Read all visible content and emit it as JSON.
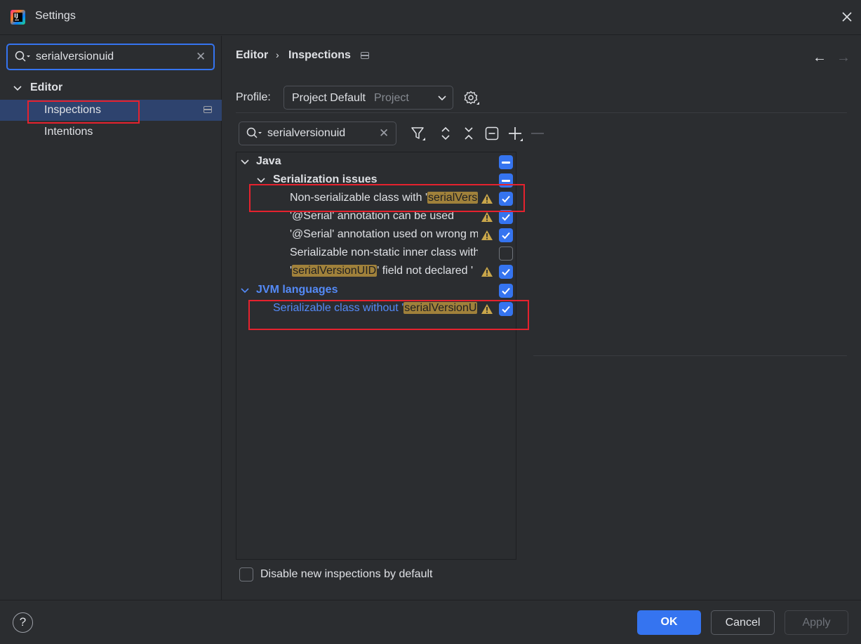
{
  "window": {
    "title": "Settings"
  },
  "sidebar": {
    "search_value": "serialversionuid",
    "tree": {
      "group_label": "Editor",
      "items": [
        {
          "label": "Inspections",
          "selected": true
        },
        {
          "label": "Intentions",
          "selected": false
        }
      ]
    }
  },
  "breadcrumb": {
    "parent": "Editor",
    "separator": "›",
    "current": "Inspections"
  },
  "nav": {
    "back": "←",
    "forward": "→"
  },
  "profile": {
    "label": "Profile:",
    "value": "Project Default",
    "scope": "Project"
  },
  "inspection_search": {
    "value": "serialversionuid"
  },
  "tree": {
    "groups": [
      {
        "label": "Java",
        "state": "mixed",
        "subgroups": [
          {
            "label": "Serialization issues",
            "state": "mixed",
            "items": [
              {
                "pre": "Non-serializable class with '",
                "highlight": "serialVers",
                "post": "",
                "warning": true,
                "checked": true
              },
              {
                "pre": "'@Serial' annotation can be used",
                "highlight": "",
                "post": "",
                "warning": true,
                "checked": true
              },
              {
                "pre": "'@Serial' annotation used on wrong m",
                "highlight": "",
                "post": "",
                "warning": true,
                "checked": true
              },
              {
                "pre": "Serializable non-static inner class with",
                "highlight": "",
                "post": "",
                "warning": false,
                "checked": false
              },
              {
                "pre": "'",
                "highlight": "serialVersionUID",
                "post": "' field not declared '",
                "warning": true,
                "checked": true
              }
            ]
          }
        ]
      },
      {
        "label": "JVM languages",
        "state": "checked",
        "items": [
          {
            "pre": "Serializable class without '",
            "highlight": "serialVersionU",
            "post": "",
            "warning": true,
            "checked": true
          }
        ]
      }
    ]
  },
  "footer": {
    "disable_new_label": "Disable new inspections by default",
    "help_label": "?",
    "ok_label": "OK",
    "cancel_label": "Cancel",
    "apply_label": "Apply"
  },
  "colors": {
    "accent": "#3574f0",
    "selection": "#2e436e",
    "search_highlight": "#a0813b",
    "warning": "#c9a64a",
    "annotation_box": "#e5222e",
    "link_text": "#548af7"
  }
}
